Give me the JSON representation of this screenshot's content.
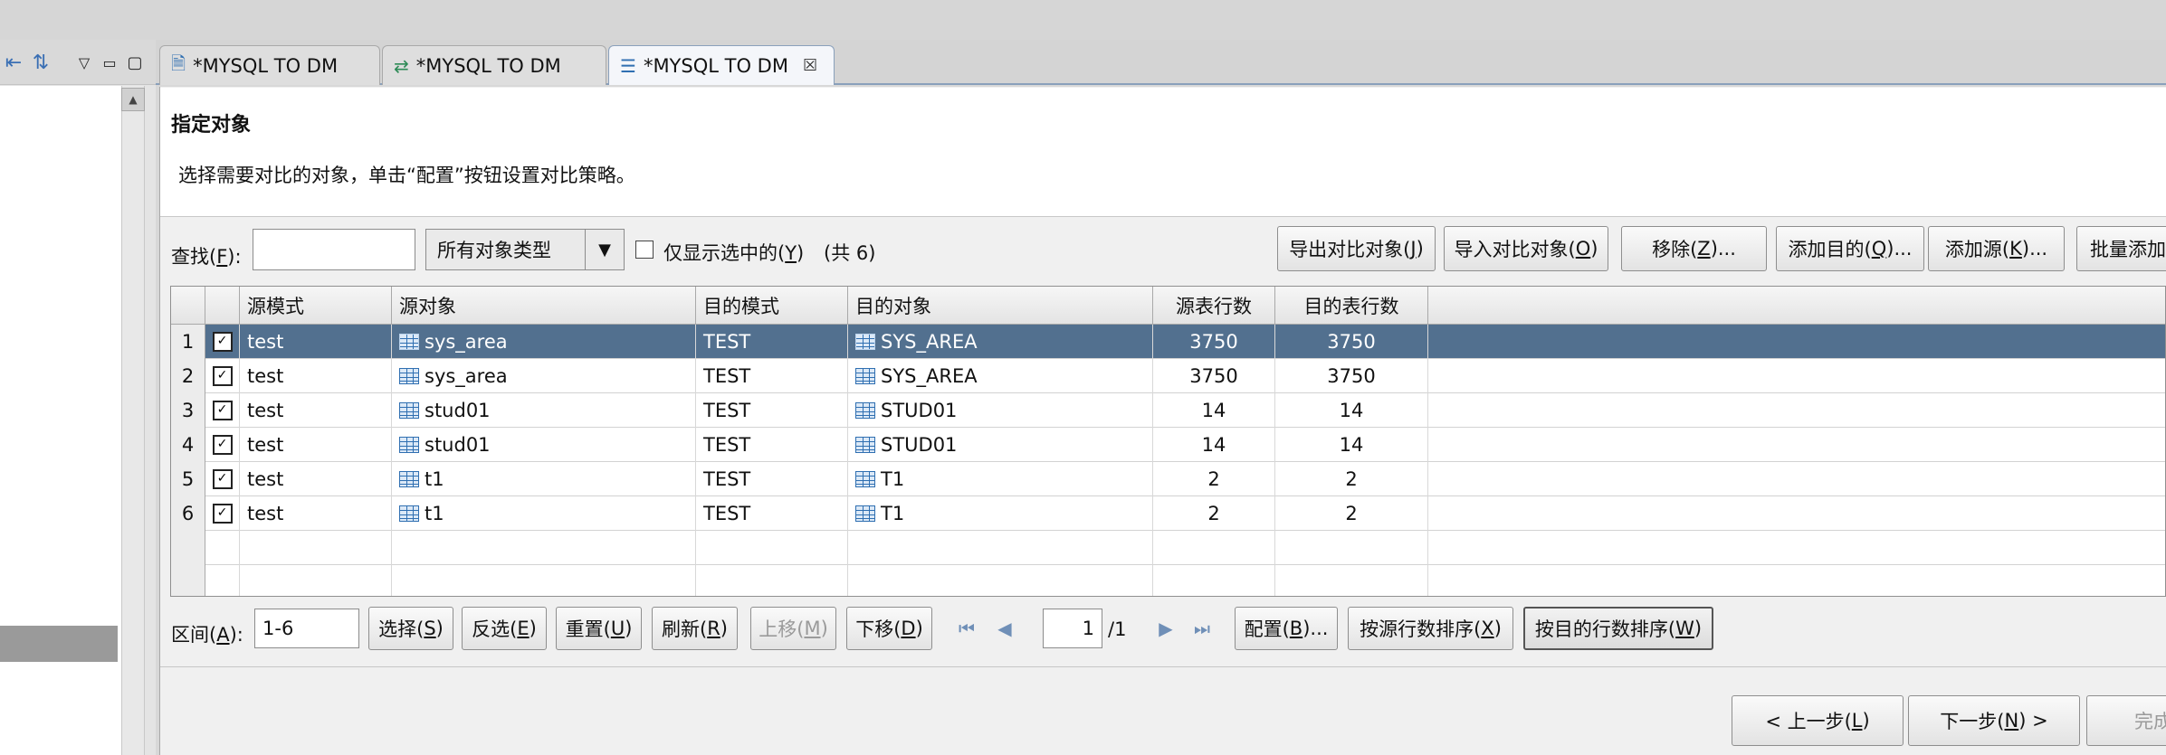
{
  "tabs": [
    {
      "label": "*MYSQL TO DM",
      "icon": "document-icon"
    },
    {
      "label": "*MYSQL TO DM",
      "icon": "sync-arrows-icon"
    },
    {
      "label": "*MYSQL TO DM",
      "icon": "compare-list-icon",
      "active": true
    }
  ],
  "header": {
    "title": "指定对象",
    "description": "选择需要对比的对象，单击“配置”按钮设置对比策略。"
  },
  "toolbar": {
    "search_label": "查找(",
    "search_key": "F",
    "search_label_end": "):",
    "search_value": "",
    "type_select": "所有对象类型",
    "only_selected_label": "仅显示选中的(",
    "only_selected_key": "Y",
    "only_selected_end": ")",
    "count": "(共 6)",
    "buttons": [
      {
        "label": "导出对比对象(",
        "key": "J",
        "end": ")"
      },
      {
        "label": "导入对比对象(",
        "key": "O",
        "end": ")"
      },
      {
        "label": "移除(",
        "key": "Z",
        "end": ")..."
      },
      {
        "label": "添加目的(",
        "key": "Q",
        "end": ")..."
      },
      {
        "label": "添加源(",
        "key": "K",
        "end": ")..."
      },
      {
        "label": "批量添加",
        "key": "",
        "end": ""
      }
    ]
  },
  "table": {
    "columns": [
      "",
      "",
      "源模式",
      "源对象",
      "目的模式",
      "目的对象",
      "源表行数",
      "目的表行数"
    ],
    "rows": [
      {
        "num": "1",
        "checked": true,
        "src_schema": "test",
        "src_obj": "sys_area",
        "dst_schema": "TEST",
        "dst_obj": "SYS_AREA",
        "src_rows": "3750",
        "dst_rows": "3750",
        "selected": true
      },
      {
        "num": "2",
        "checked": true,
        "src_schema": "test",
        "src_obj": "sys_area",
        "dst_schema": "TEST",
        "dst_obj": "SYS_AREA",
        "src_rows": "3750",
        "dst_rows": "3750"
      },
      {
        "num": "3",
        "checked": true,
        "src_schema": "test",
        "src_obj": "stud01",
        "dst_schema": "TEST",
        "dst_obj": "STUD01",
        "src_rows": "14",
        "dst_rows": "14"
      },
      {
        "num": "4",
        "checked": true,
        "src_schema": "test",
        "src_obj": "stud01",
        "dst_schema": "TEST",
        "dst_obj": "STUD01",
        "src_rows": "14",
        "dst_rows": "14"
      },
      {
        "num": "5",
        "checked": true,
        "src_schema": "test",
        "src_obj": "t1",
        "dst_schema": "TEST",
        "dst_obj": "T1",
        "src_rows": "2",
        "dst_rows": "2"
      },
      {
        "num": "6",
        "checked": true,
        "src_schema": "test",
        "src_obj": "t1",
        "dst_schema": "TEST",
        "dst_obj": "T1",
        "src_rows": "2",
        "dst_rows": "2"
      }
    ],
    "check_mark": "✓"
  },
  "bottom": {
    "range_label": "区间(",
    "range_key": "A",
    "range_end": "):",
    "range_value": "1-6",
    "page_value": "1",
    "page_total": "/1",
    "buttons": [
      {
        "label": "选择(",
        "key": "S",
        "end": ")"
      },
      {
        "label": "反选(",
        "key": "E",
        "end": ")"
      },
      {
        "label": "重置(",
        "key": "U",
        "end": ")"
      },
      {
        "label": "刷新(",
        "key": "R",
        "end": ")"
      },
      {
        "label": "上移(",
        "key": "M",
        "end": ")",
        "disabled": true
      },
      {
        "label": "下移(",
        "key": "D",
        "end": ")"
      },
      {
        "label": "配置(",
        "key": "B",
        "end": ")..."
      },
      {
        "label": "按源行数排序(",
        "key": "X",
        "end": ")"
      },
      {
        "label": "按目的行数排序(",
        "key": "W",
        "end": ")"
      }
    ]
  },
  "footer": {
    "prev": {
      "label": "< 上一步(",
      "key": "L",
      "end": ")"
    },
    "next": {
      "label": "下一步(",
      "key": "N",
      "end": ") >"
    },
    "finish": {
      "label": "完成"
    }
  },
  "glyphs": {
    "tab_close": "☒",
    "dropdown": "▼",
    "first": "⏮",
    "prev": "◀",
    "next": "▶",
    "last": "⏭",
    "scroll_up": "▲"
  }
}
